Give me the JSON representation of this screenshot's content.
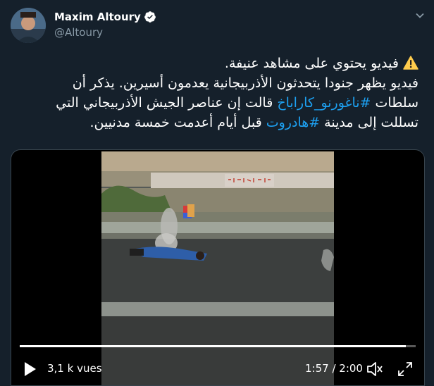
{
  "author": {
    "display_name": "Maxim Altoury",
    "handle": "@Altoury"
  },
  "tweet": {
    "line1": " فيديو يحتوي على مشاهد عنيفة.",
    "line2": "فيديو يظهر جنودا يتحدثون الأذربيجانية يعدمون أسيرين. يذكر أن",
    "line3_before": "سلطات ",
    "line3_hashtag": "#ناغورنو_كاراباخ",
    "line3_after": " قالت إن عناصر الجيش الأذربيجاني التي",
    "line4_before": "تسللت إلى مدينة ",
    "line4_hashtag": "#هادروت",
    "line4_after": " قبل أيام أعدمت خمسة مدنيين."
  },
  "video": {
    "views": "3,1 k vues",
    "time": "1:57 / 2:00",
    "progress": 0.975
  },
  "colors": {
    "background": "#15202b",
    "hashtag": "#1da1f2",
    "secondary_text": "#8899a6"
  }
}
